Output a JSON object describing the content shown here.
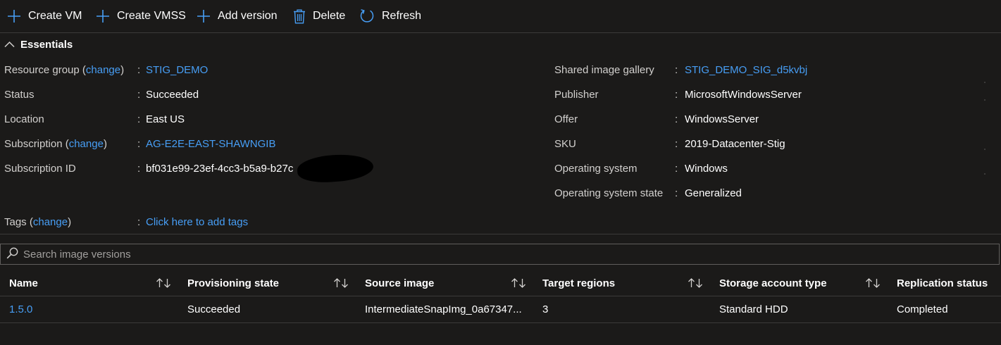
{
  "toolbar": {
    "create_vm": "Create VM",
    "create_vmss": "Create VMSS",
    "add_version": "Add version",
    "delete": "Delete",
    "refresh": "Refresh"
  },
  "essentials": {
    "title": "Essentials",
    "left": {
      "resource_group_label": "Resource group",
      "change": "change",
      "resource_group_value": "STIG_DEMO",
      "status_label": "Status",
      "status_value": "Succeeded",
      "location_label": "Location",
      "location_value": "East US",
      "subscription_label": "Subscription",
      "subscription_value": "AG-E2E-EAST-SHAWNGIB",
      "subscription_id_label": "Subscription ID",
      "subscription_id_value": "bf031e99-23ef-4cc3-b5a9-b27c",
      "tags_label": "Tags",
      "tags_value": "Click here to add tags"
    },
    "right": {
      "gallery_label": "Shared image gallery",
      "gallery_value": "STIG_DEMO_SIG_d5kvbj",
      "publisher_label": "Publisher",
      "publisher_value": "MicrosoftWindowsServer",
      "offer_label": "Offer",
      "offer_value": "WindowsServer",
      "sku_label": "SKU",
      "sku_value": "2019-Datacenter-Stig",
      "os_label": "Operating system",
      "os_value": "Windows",
      "os_state_label": "Operating system state",
      "os_state_value": "Generalized"
    },
    "separator": ":",
    "paren_open": "(",
    "paren_close": ")"
  },
  "search": {
    "placeholder": "Search image versions"
  },
  "grid": {
    "columns": [
      "Name",
      "Provisioning state",
      "Source image",
      "Target regions",
      "Storage account type",
      "Replication status"
    ],
    "rows": [
      [
        "1.5.0",
        "Succeeded",
        "IntermediateSnapImg_0a67347...",
        "3",
        "Standard HDD",
        "Completed"
      ]
    ]
  },
  "colors": {
    "background": "#1b1a19",
    "link": "#479ef5",
    "accent": "#0078d4"
  },
  "icons": [
    "plus-icon",
    "trash-icon",
    "refresh-icon",
    "chevron-up-icon",
    "search-icon",
    "sort-icon"
  ]
}
